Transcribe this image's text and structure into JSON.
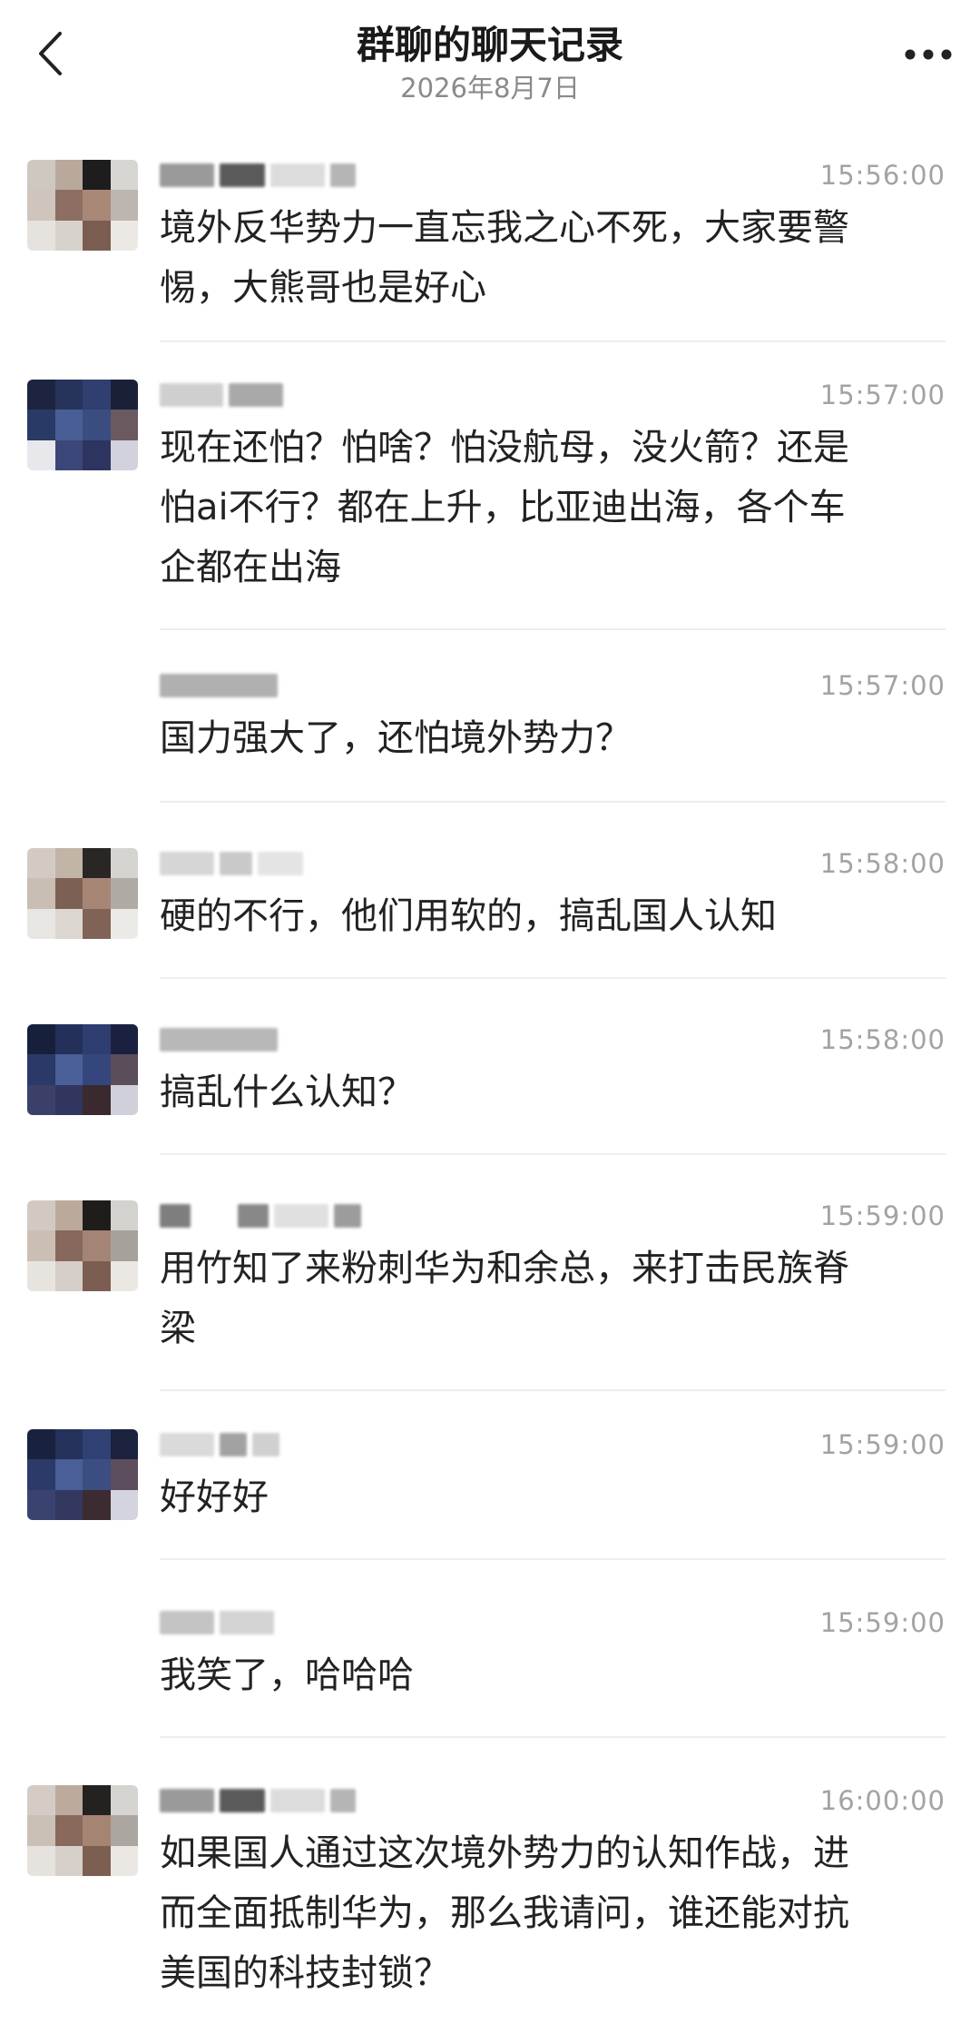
{
  "header": {
    "title": "群聊的聊天记录",
    "date": "2026年8月7日",
    "back_icon": "chevron-left-icon",
    "more_icon": "more-dots-icon"
  },
  "messages": [
    {
      "time": "15:56:00",
      "text": "境外反华势力一直忘我之心不死，大家要警\n惕，大熊哥也是好心"
    },
    {
      "time": "15:57:00",
      "text": "现在还怕？怕啥？怕没航母，没火箭？还是\n怕ai不行？都在上升，比亚迪出海，各个车\n企都在出海"
    },
    {
      "time": "15:57:00",
      "text": "国力强大了，还怕境外势力？"
    },
    {
      "time": "15:58:00",
      "text": "硬的不行，他们用软的，搞乱国人认知"
    },
    {
      "time": "15:58:00",
      "text": "搞乱什么认知？"
    },
    {
      "time": "15:59:00",
      "text": "用竹知了来粉刺华为和余总，来打击民族脊\n梁"
    },
    {
      "time": "15:59:00",
      "text": "好好好"
    },
    {
      "time": "15:59:00",
      "text": "我笑了，哈哈哈"
    },
    {
      "time": "16:00:00",
      "text": "如果国人通过这次境外势力的认知作战，进\n而全面抵制华为，那么我请问，谁还能对抗\n美国的科技封锁？"
    }
  ]
}
